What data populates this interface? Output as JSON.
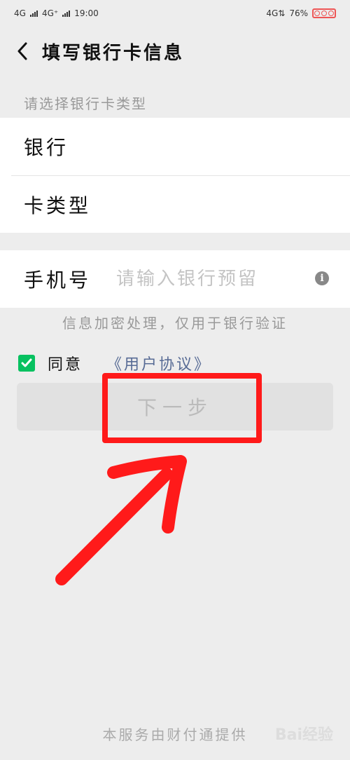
{
  "status_bar": {
    "network_1": "4G",
    "network_2": "4G⁺",
    "time": "19:00",
    "network_right": "4G⇅",
    "battery": "76%"
  },
  "header": {
    "title": "填写银行卡信息"
  },
  "form": {
    "section_hint": "请选择银行卡类型",
    "bank_label": "银行",
    "card_type_label": "卡类型",
    "phone_label": "手机号",
    "phone_placeholder": "请输入银行预留",
    "encrypt_note": "信息加密处理，仅用于银行验证",
    "agree_label": "同意",
    "agreement_link": "《用户协议》",
    "next_button": "下一步"
  },
  "footer": {
    "provider": "本服务由财付通提供",
    "watermark": "Bai经验"
  },
  "colors": {
    "accent_green": "#07c160",
    "link_blue": "#576b95",
    "highlight_red": "#ff1a1a"
  }
}
